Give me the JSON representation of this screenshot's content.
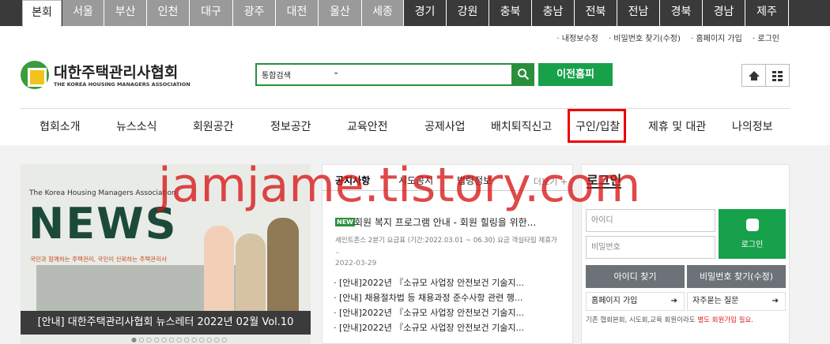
{
  "region_tabs": [
    "본회",
    "서울",
    "부산",
    "인천",
    "대구",
    "광주",
    "대전",
    "울산",
    "세종",
    "경기",
    "강원",
    "충북",
    "충남",
    "전북",
    "전남",
    "경북",
    "경남",
    "제주"
  ],
  "util_links": [
    "· 내정보수정",
    "· 비밀번호 찾기(수정)",
    "· 홈페이지 가입",
    "· 로그인"
  ],
  "logo": {
    "name": "대한주택관리사협회",
    "sub": "THE KOREA HOUSING MANAGERS ASSOCIATION"
  },
  "search": {
    "select": "통합검색",
    "caret": "⌄"
  },
  "old_home_label": "이전홈피",
  "gnb": [
    "협회소개",
    "뉴스소식",
    "회원공간",
    "정보공간",
    "교육안전",
    "공제사업",
    "배치퇴직신고",
    "구인/입찰",
    "제휴 및 대관",
    "나의정보"
  ],
  "banner": {
    "tag": "The Korea Housing Managers Association",
    "title": "NEWS",
    "slogan": "국민과 함께하는 주택관리, 국민이 신뢰하는 주택관리사",
    "caption": "[안내] 대한주택관리사협회 뉴스레터 2022년 02월 Vol.10",
    "dots": "● ○ ○ ○ ○ ○ ○ ○ ○ ○ ○ ○ ○"
  },
  "board": {
    "tabs": [
      "공지사항",
      "시도공지",
      "법령정보"
    ],
    "more": "더보기 +",
    "new_badge": "NEW",
    "headline": "회원 복지 프로그램 안내 - 회원 힐링을 위한...",
    "excerpt": "세인트존스 2분기 요금표 (기간:2022.03.01 ~ 06.30) 요금 객실타입 제휴가 ..",
    "date": "2022-03-29",
    "list": [
      "· [안내]2022년 『소규모 사업장 안전보건 기술지...",
      "· [안내] 채용절차법 등 채용과정 준수사항 관련 행...",
      "· [안내]2022년 『소규모 사업장 안전보건 기술지...",
      "· [안내]2022년 『소규모 사업장 안전보건 기술지..."
    ]
  },
  "login": {
    "title": "로그인",
    "id_placeholder": "아이디",
    "pw_placeholder": "비밀번호",
    "login_button": "로그인",
    "find_id": "아이디 찾기",
    "find_pw": "비밀번호 찾기(수정)",
    "join": "홈페이지 가입",
    "faq": "자주묻는 질문",
    "arrow": "➔",
    "note_prefix": "기존 협회본회, 시도회,교육 회원이라도 ",
    "note_red": "별도 회원가입 필요."
  },
  "watermark": "jamjame.tistory.com"
}
